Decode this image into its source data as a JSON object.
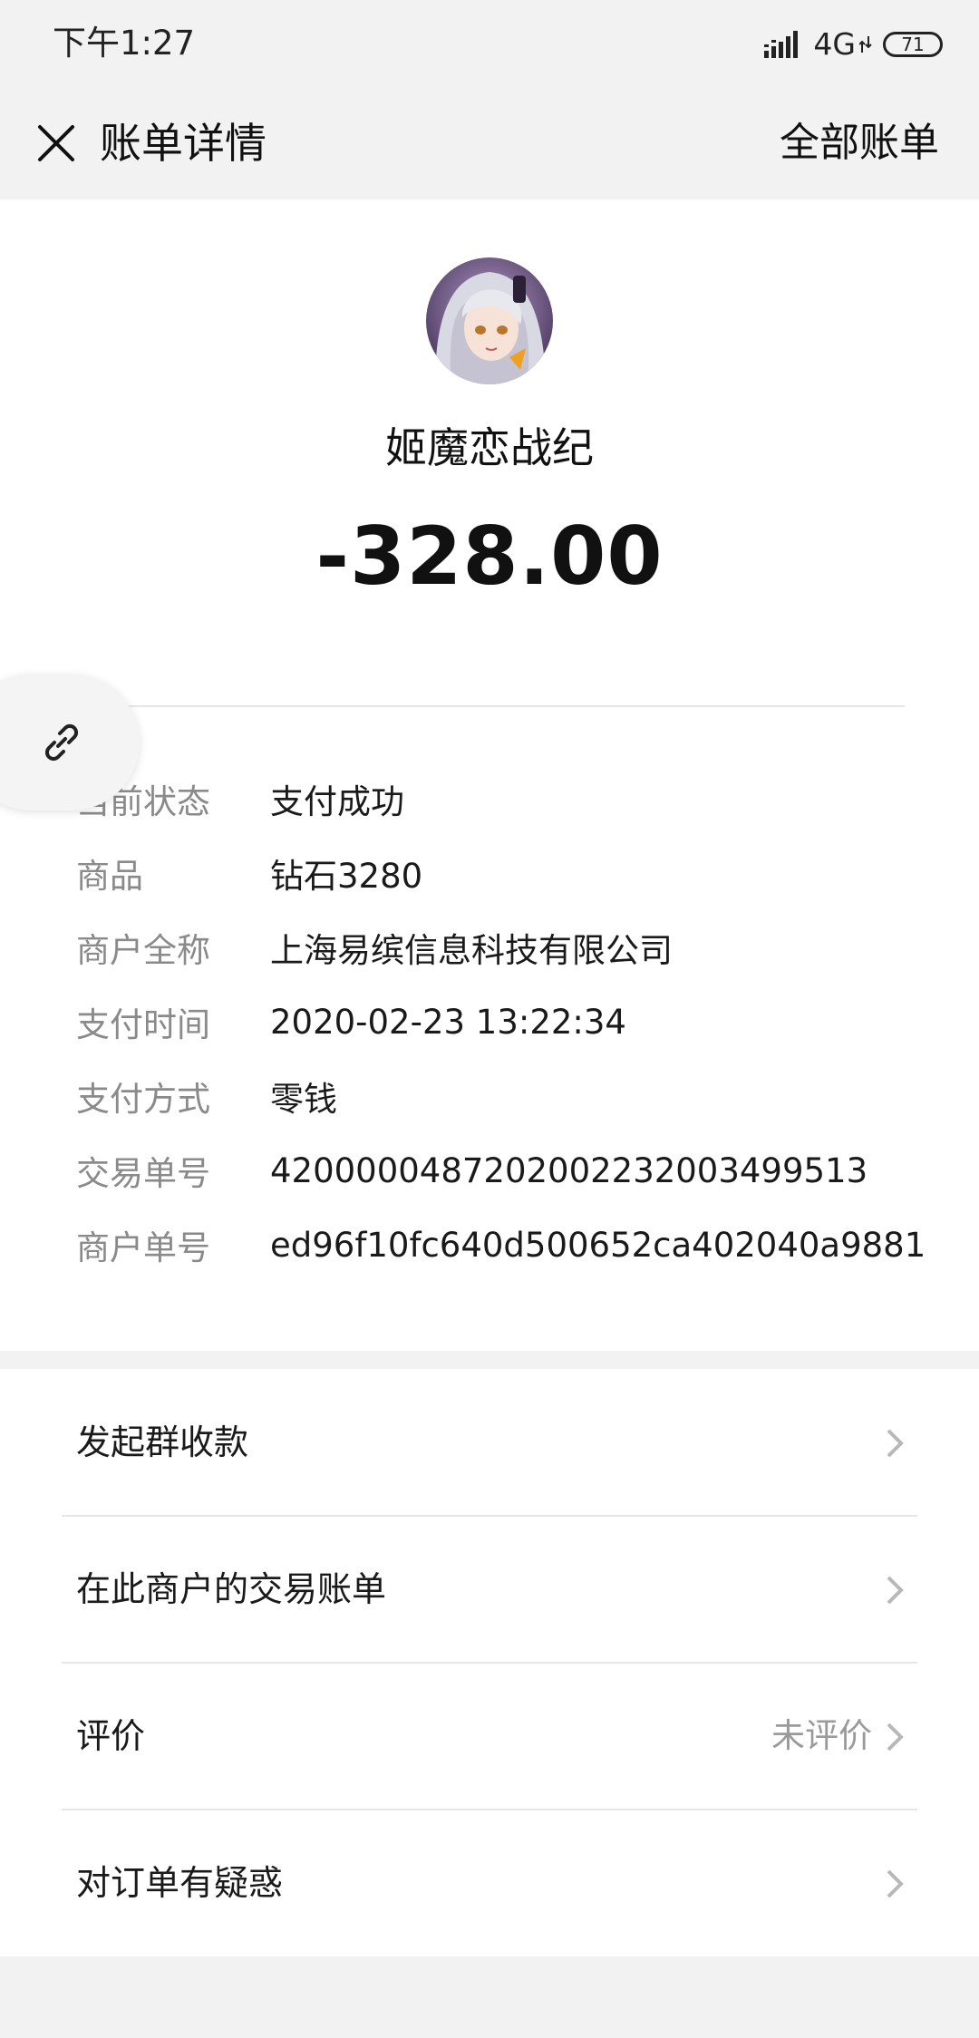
{
  "status_bar": {
    "time": "下午1:27",
    "network": "4G",
    "battery": "71",
    "icons": [
      "signal-icon",
      "data-arrows-icon",
      "battery-icon"
    ]
  },
  "nav": {
    "title": "账单详情",
    "action": "全部账单",
    "close_icon": "close-icon"
  },
  "merchant": {
    "name": "姬魔恋战纪",
    "amount": "-328.00",
    "avatar": "avatar-anime-character"
  },
  "details": [
    {
      "label": "当前状态",
      "value": "支付成功"
    },
    {
      "label": "商品",
      "value": "钻石3280"
    },
    {
      "label": "商户全称",
      "value": "上海易缤信息科技有限公司"
    },
    {
      "label": "支付时间",
      "value": "2020-02-23 13:22:34"
    },
    {
      "label": "支付方式",
      "value": "零钱"
    },
    {
      "label": "交易单号",
      "value": "4200000487202002232003499513"
    },
    {
      "label": "商户单号",
      "value": "ed96f10fc640d500652ca402040a9881"
    }
  ],
  "float_button": {
    "icon": "link-icon"
  },
  "actions": [
    {
      "label": "发起群收款",
      "sub": ""
    },
    {
      "label": "在此商户的交易账单",
      "sub": ""
    },
    {
      "label": "评价",
      "sub": "未评价"
    },
    {
      "label": "对订单有疑惑",
      "sub": ""
    }
  ],
  "colors": {
    "background": "#f2f2f2",
    "card": "#ffffff",
    "label_gray": "#8a8a8a",
    "text_dark": "#1a1a1a"
  }
}
